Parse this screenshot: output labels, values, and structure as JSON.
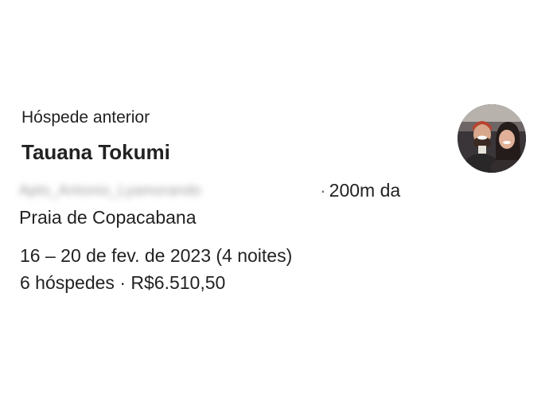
{
  "card": {
    "status_label": "Hóspede anterior",
    "guest_name": "Tauana Tokumi",
    "listing": {
      "name_blurred": "Apto_Antonio_Lyamorando",
      "separator": "·",
      "distance_part1": "200m da",
      "distance_part2": "Praia de Copacabana"
    },
    "dates": "16 – 20 de fev. de 2023 (4 noites)",
    "guests": "6 hóspedes",
    "separator": "·",
    "price": "R$6.510,50",
    "avatar_icon": "guest-avatar-photo"
  }
}
